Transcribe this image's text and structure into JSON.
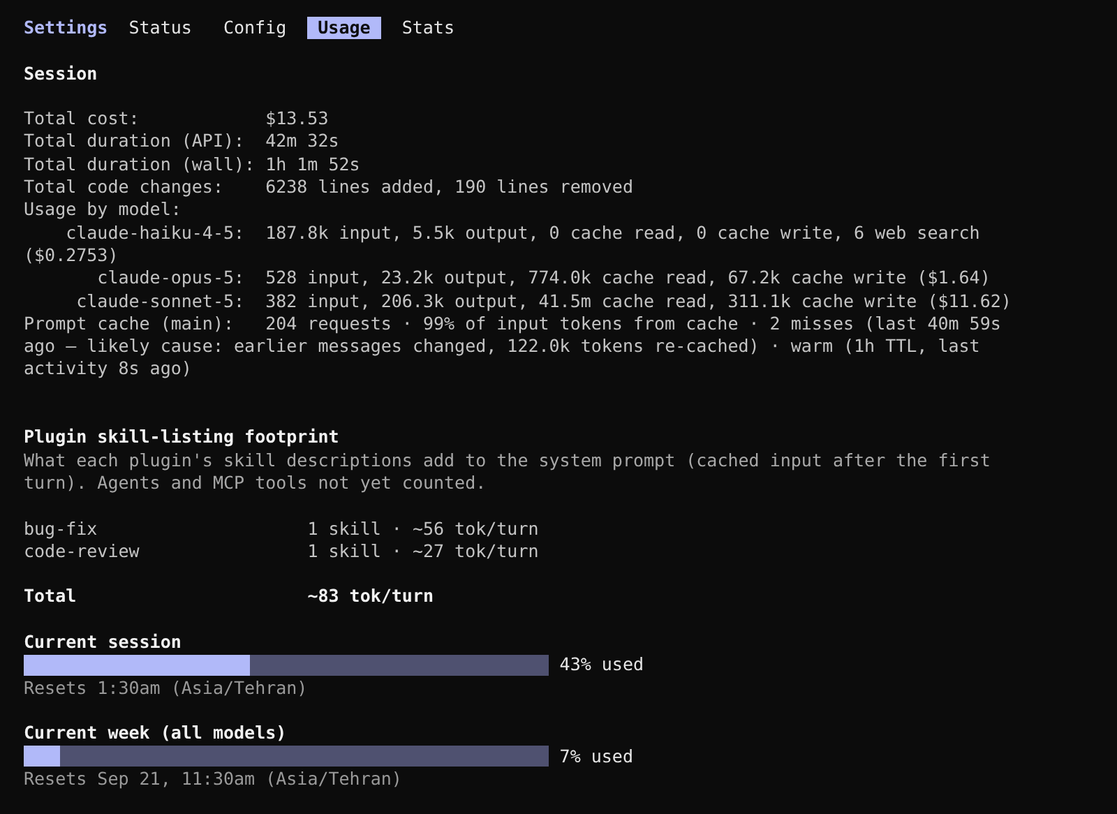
{
  "header": {
    "title": "Settings",
    "tabs": [
      {
        "label": "Status",
        "selected": false
      },
      {
        "label": "Config",
        "selected": false
      },
      {
        "label": "Usage",
        "selected": true
      },
      {
        "label": "Stats",
        "selected": false
      }
    ]
  },
  "session": {
    "title": "Session",
    "stats": [
      {
        "label": "Total cost:",
        "value": "$13.53"
      },
      {
        "label": "Total duration (API):",
        "value": "42m 32s"
      },
      {
        "label": "Total duration (wall):",
        "value": "1h 1m 52s"
      },
      {
        "label": "Total code changes:",
        "value": "6238 lines added, 190 lines removed"
      }
    ],
    "usage_by_model_label": "Usage by model:",
    "models": [
      {
        "name": "claude-haiku-4-5:",
        "usage": "187.8k input, 5.5k output, 0 cache read, 0 cache write, 6 web search ($0.2753)"
      },
      {
        "name": "claude-opus-5:",
        "usage": "528 input, 23.2k output, 774.0k cache read, 67.2k cache write ($1.64)"
      },
      {
        "name": "claude-sonnet-5:",
        "usage": "382 input, 206.3k output, 41.5m cache read, 311.1k cache write ($11.62)"
      }
    ],
    "prompt_cache": {
      "label": "Prompt cache (main):",
      "value": "204 requests · 99% of input tokens from cache · 2 misses (last 40m 59s ago — likely cause: earlier messages changed, 122.0k tokens re-cached) · warm (1h TTL, last activity 8s ago)"
    }
  },
  "plugins": {
    "title": "Plugin skill-listing footprint",
    "description": "What each plugin's skill descriptions add to the system prompt (cached input after the first turn). Agents and MCP tools not yet counted.",
    "rows": [
      {
        "name": "bug-fix",
        "value": "1 skill · ~56 tok/turn"
      },
      {
        "name": "code-review",
        "value": "1 skill · ~27 tok/turn"
      }
    ],
    "total": {
      "label": "Total",
      "value": "~83 tok/turn"
    }
  },
  "limits": [
    {
      "title": "Current session",
      "level": 0.43,
      "reading": "43% used",
      "resets": "Resets 1:30am (Asia/Tehran)"
    },
    {
      "title": "Current week (all models)",
      "level": 0.07,
      "reading": "7% used",
      "resets": "Resets Sep 21, 11:30am (Asia/Tehran)"
    }
  ]
}
